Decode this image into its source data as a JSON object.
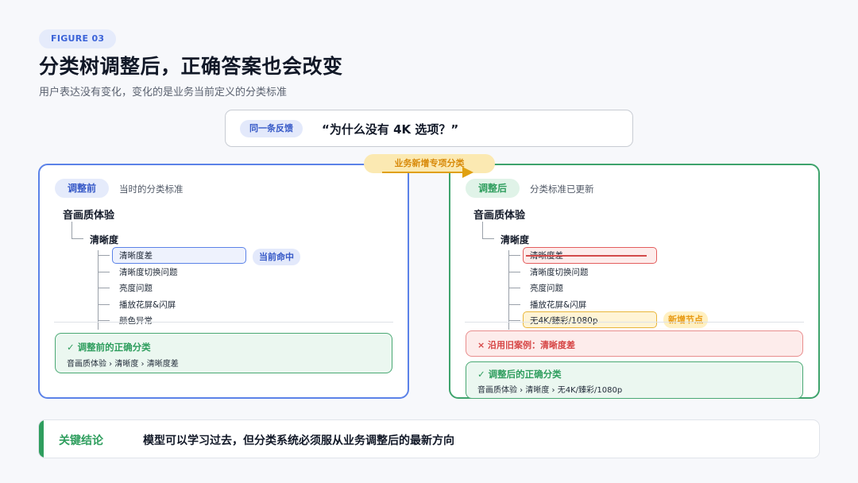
{
  "header": {
    "figure_label": "FIGURE 03",
    "title": "分类树调整后，正确答案也会改变",
    "subtitle": "用户表达没有变化，变化的是业务当前定义的分类标准"
  },
  "feedback": {
    "tag": "同一条反馈",
    "quote": "“为什么没有 4K 选项？”"
  },
  "transition": {
    "label": "业务新增专项分类"
  },
  "before": {
    "tag": "调整前",
    "caption": "当时的分类标准",
    "root": "音画质体验",
    "branch": "清晰度",
    "leaves": [
      "清晰度差",
      "清晰度切换问题",
      "亮度问题",
      "播放花屏&闪屏",
      "颜色异常"
    ],
    "hit_label": "当前命中",
    "correct_title": "✓ 调整前的正确分类",
    "correct_path": "音画质体验 › 清晰度 › 清晰度差"
  },
  "after": {
    "tag": "调整后",
    "caption": "分类标准已更新",
    "root": "音画质体验",
    "branch": "清晰度",
    "leaves": [
      "清晰度差",
      "清晰度切换问题",
      "亮度问题",
      "播放花屏&闪屏",
      "无4K/臻彩/1080p"
    ],
    "new_label": "新增节点",
    "wrong_text": "× 沿用旧案例：清晰度差",
    "correct_title": "✓ 调整后的正确分类",
    "correct_path": "音画质体验 › 清晰度 › 无4K/臻彩/1080p"
  },
  "conclusion": {
    "label": "关键结论",
    "text": "模型可以学习过去，但分类系统必须服从业务调整后的最新方向"
  },
  "colors": {
    "blue_accent": "#5b82e8",
    "green_accent": "#3ea36c",
    "red_accent": "#e35d5d",
    "yellow_accent": "#e9b63a"
  }
}
